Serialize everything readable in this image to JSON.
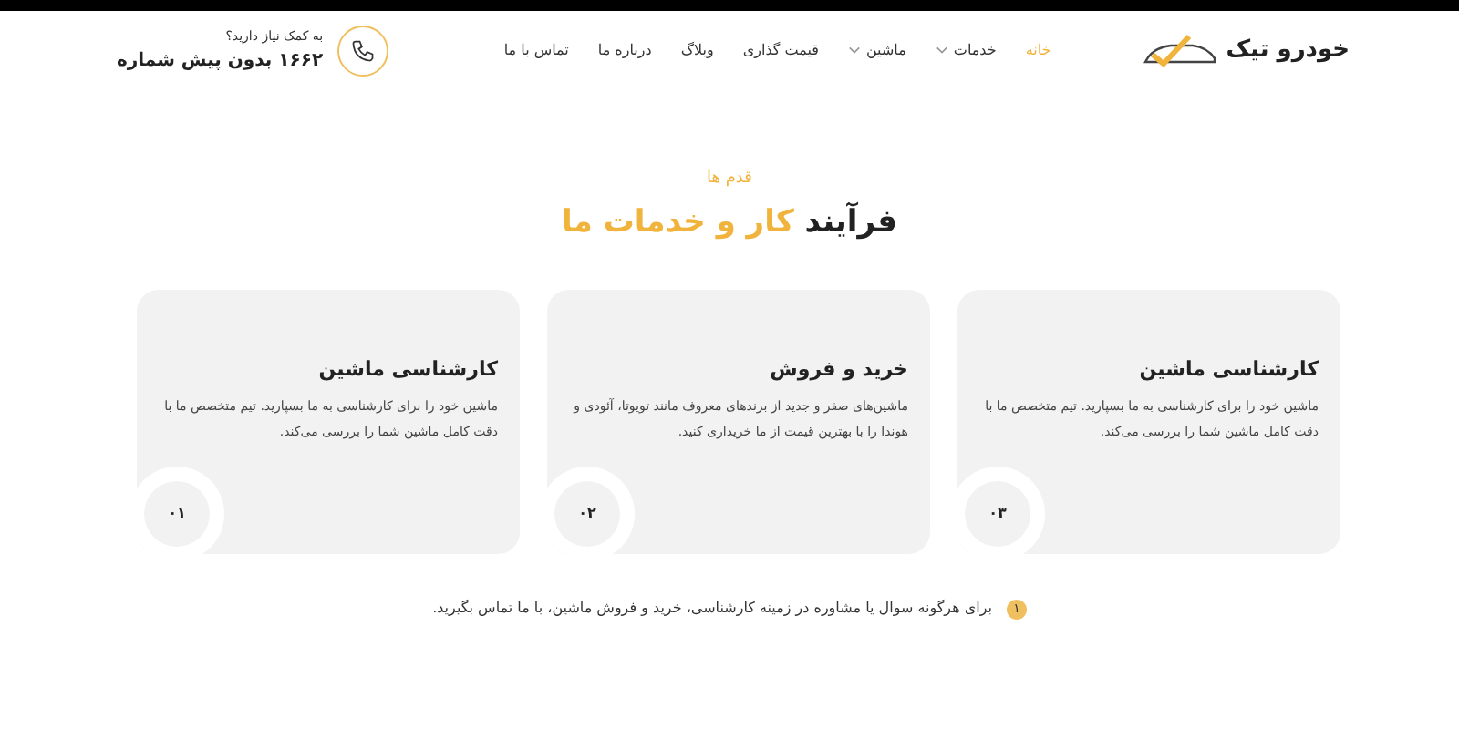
{
  "header": {
    "logo": "خودرو تیک",
    "nav": [
      {
        "label": "خانه",
        "selected": true,
        "dropdown": false
      },
      {
        "label": "خدمات",
        "selected": false,
        "dropdown": true
      },
      {
        "label": "ماشین",
        "selected": false,
        "dropdown": true
      },
      {
        "label": "قیمت گذاری",
        "selected": false,
        "dropdown": false
      },
      {
        "label": "وبلاگ",
        "selected": false,
        "dropdown": false
      },
      {
        "label": "درباره ما",
        "selected": false,
        "dropdown": false
      },
      {
        "label": "تماس با ما",
        "selected": false,
        "dropdown": false
      }
    ],
    "help": {
      "question": "به کمک نیاز دارید؟",
      "phone": "۱۶۶۲ بدون پیش شماره"
    }
  },
  "section": {
    "eyebrow": "قدم ها",
    "title": "فرآیند",
    "title_highlight": "کار و خدمات ما"
  },
  "cards": [
    {
      "title": "کارشناسی ماشین",
      "text": "ماشین خود را برای کارشناسی به ما بسپارید. تیم متخصص ما با دقت کامل ماشین شما را بررسی می‌کند.",
      "number": "۰۳"
    },
    {
      "title": "خرید و فروش",
      "text": "ماشین‌های صفر و جدید از برندهای معروف مانند تویوتا، آئودی و هوندا را با بهترین قیمت از ما خریداری کنید.",
      "number": "۰۲"
    },
    {
      "title": "کارشناسی ماشین",
      "text": "ماشین خود را برای کارشناسی به ما بسپارید. تیم متخصص ما با دقت کامل ماشین شما را بررسی می‌کند.",
      "number": "۰۱"
    }
  ],
  "note": {
    "badge": "۱",
    "text": "برای هرگونه سوال یا مشاوره در زمینه کارشناسی، خرید و فروش ماشین، با ما تماس بگیرید."
  }
}
